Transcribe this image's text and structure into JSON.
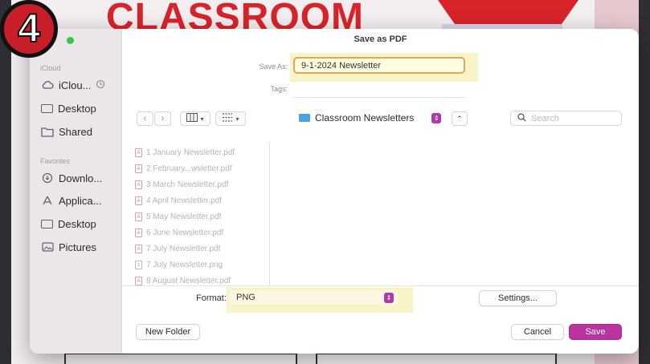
{
  "step_number": "4",
  "background": {
    "headline": "CLASSROOM"
  },
  "dialog": {
    "title": "Save as PDF",
    "save_as_label": "Save As:",
    "save_as_value": "9-1-2024 Newsletter",
    "tags_label": "Tags:",
    "location": "Classroom Newsletters",
    "search_placeholder": "Search",
    "format_label": "Format:",
    "format_value": "PNG",
    "settings_button": "Settings...",
    "new_folder_button": "New Folder",
    "cancel_button": "Cancel",
    "save_button": "Save"
  },
  "sidebar": {
    "section_icloud": "iCloud",
    "section_favorites": "Favorites",
    "icloud_items": [
      {
        "label": "iClou...",
        "icon": "cloud-icon"
      },
      {
        "label": "Desktop",
        "icon": "desktop-icon"
      },
      {
        "label": "Shared",
        "icon": "shared-folder-icon"
      }
    ],
    "favorite_items": [
      {
        "label": "Downlo...",
        "icon": "download-icon"
      },
      {
        "label": "Applica...",
        "icon": "applications-icon"
      },
      {
        "label": "Desktop",
        "icon": "desktop-icon"
      },
      {
        "label": "Pictures",
        "icon": "pictures-icon"
      }
    ]
  },
  "files": [
    {
      "name": "1 January Newsletter.pdf",
      "type": "pdf"
    },
    {
      "name": "2 February...wsletter.pdf",
      "type": "pdf"
    },
    {
      "name": "3 March Newsletter.pdf",
      "type": "pdf"
    },
    {
      "name": "4 April Newsletter.pdf",
      "type": "pdf"
    },
    {
      "name": "5 May Newsletter.pdf",
      "type": "pdf"
    },
    {
      "name": "6 June Newsletter.pdf",
      "type": "pdf"
    },
    {
      "name": "7 July Newsletter.pdf",
      "type": "pdf"
    },
    {
      "name": "7 July Newsletter.png",
      "type": "png"
    },
    {
      "name": "8 August Newsletter.pdf",
      "type": "pdf"
    }
  ],
  "colors": {
    "accent": "#b8349e",
    "badge": "#c81e2a",
    "highlight": "#f8f4c7",
    "folder": "#4aa3df"
  }
}
